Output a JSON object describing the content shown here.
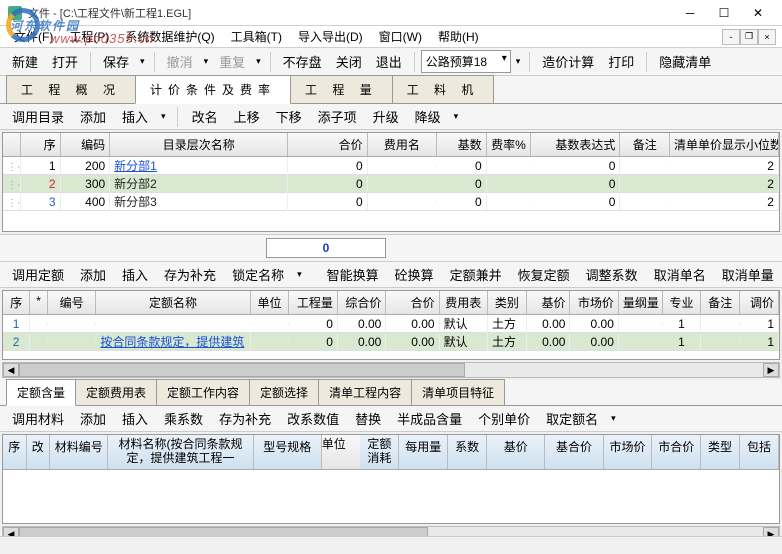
{
  "window": {
    "title": "文件 - [C:\\工程文件\\新工程1.EGL]"
  },
  "watermark": {
    "text": "河东软件园",
    "url": "www.pc0359.cn"
  },
  "menu": [
    "文件(F)",
    "工程(P)",
    "系统数据维护(Q)",
    "工具箱(T)",
    "导入导出(D)",
    "窗口(W)",
    "帮助(H)"
  ],
  "toolbar_main": {
    "new": "新建",
    "open": "打开",
    "save": "保存",
    "undo": "撤消",
    "redo": "重复",
    "nosave": "不存盘",
    "close": "关闭",
    "exit": "退出",
    "combo": "公路预算18",
    "calc": "造价计算",
    "print": "打印",
    "hide": "隐藏清单"
  },
  "tabs_main": [
    "工 程 概 况",
    "计价条件及费率",
    "工    程    量",
    "工    料    机"
  ],
  "tabs_main_active": 1,
  "toolbar_tree": {
    "load": "调用目录",
    "add": "添加",
    "insert": "插入",
    "rename": "改名",
    "moveup": "上移",
    "movedown": "下移",
    "addchild": "添子项",
    "upgrade": "升级",
    "downgrade": "降级"
  },
  "grid1": {
    "headers": [
      "序",
      "编码",
      "目录层次名称",
      "合价",
      "费用名",
      "基数",
      "费率%",
      "基数表达式",
      "备注",
      "清单单价显示小位数"
    ],
    "rows": [
      {
        "seq": "1",
        "code": "200",
        "name": "新分部1",
        "hj": "0",
        "fym": "",
        "js": "0",
        "fl": "",
        "bds": "0",
        "bz": "",
        "xws": "2",
        "alt": false,
        "link": true
      },
      {
        "seq": "2",
        "code": "300",
        "name": "新分部2",
        "hj": "0",
        "fym": "",
        "js": "0",
        "fl": "",
        "bds": "0",
        "bz": "",
        "xws": "2",
        "alt": true,
        "link": false
      },
      {
        "seq": "3",
        "code": "400",
        "name": "新分部3",
        "hj": "0",
        "fym": "",
        "js": "0",
        "fl": "",
        "bds": "0",
        "bz": "",
        "xws": "2",
        "alt": false,
        "link": false
      }
    ]
  },
  "mid_value": "0",
  "toolbar_quota": {
    "load": "调用定额",
    "add": "添加",
    "insert": "插入",
    "savebc": "存为补充",
    "lock": "锁定名称",
    "smart": "智能换算",
    "kh": "砼换算",
    "merge": "定额兼并",
    "restore": "恢复定额",
    "adjust": "调整系数",
    "cancel1": "取消单名",
    "cancel2": "取消单量"
  },
  "grid2": {
    "headers": [
      "序",
      "*",
      "编号",
      "定额名称",
      "单位",
      "工程量",
      "综合价",
      "合价",
      "费用表",
      "类别",
      "基价",
      "市场价",
      "量纲量",
      "专业",
      "备注",
      "调价"
    ],
    "rows": [
      {
        "seq": "1",
        "star": "",
        "bh": "",
        "mc": "",
        "dw": "",
        "gcl": "0",
        "zhj": "0.00",
        "hj": "0.00",
        "fym": "默认",
        "lb": "土方",
        "jj": "0.00",
        "scj": "0.00",
        "lgl": "",
        "zy": "1",
        "bz2": "",
        "tj": "1"
      },
      {
        "seq": "2",
        "star": "",
        "bh": "",
        "mc": "按合同条款规定，提供建筑",
        "dw": "",
        "gcl": "0",
        "zhj": "0.00",
        "hj": "0.00",
        "fym": "默认",
        "lb": "土方",
        "jj": "0.00",
        "scj": "0.00",
        "lgl": "",
        "zy": "1",
        "bz2": "",
        "tj": "1",
        "link": true
      }
    ]
  },
  "tabs_sub": [
    "定额含量",
    "定额费用表",
    "定额工作内容",
    "定额选择",
    "清单工程内容",
    "清单项目特征"
  ],
  "tabs_sub_active": 0,
  "toolbar_mat": {
    "load": "调用材料",
    "add": "添加",
    "insert": "插入",
    "mul": "乘系数",
    "savebc": "存为补充",
    "editval": "改系数值",
    "replace": "替换",
    "half": "半成品含量",
    "indiv": "个别单价",
    "getname": "取定额名"
  },
  "grid3": {
    "headers": [
      "序",
      "改",
      "材料编号",
      "材料名称(按合同条款规定，提供建筑工程一",
      "型号规格",
      "单位",
      "定额消耗",
      "每用量",
      "系数",
      "基价",
      "基合价",
      "市场价",
      "市合价",
      "类型",
      "包括"
    ]
  }
}
